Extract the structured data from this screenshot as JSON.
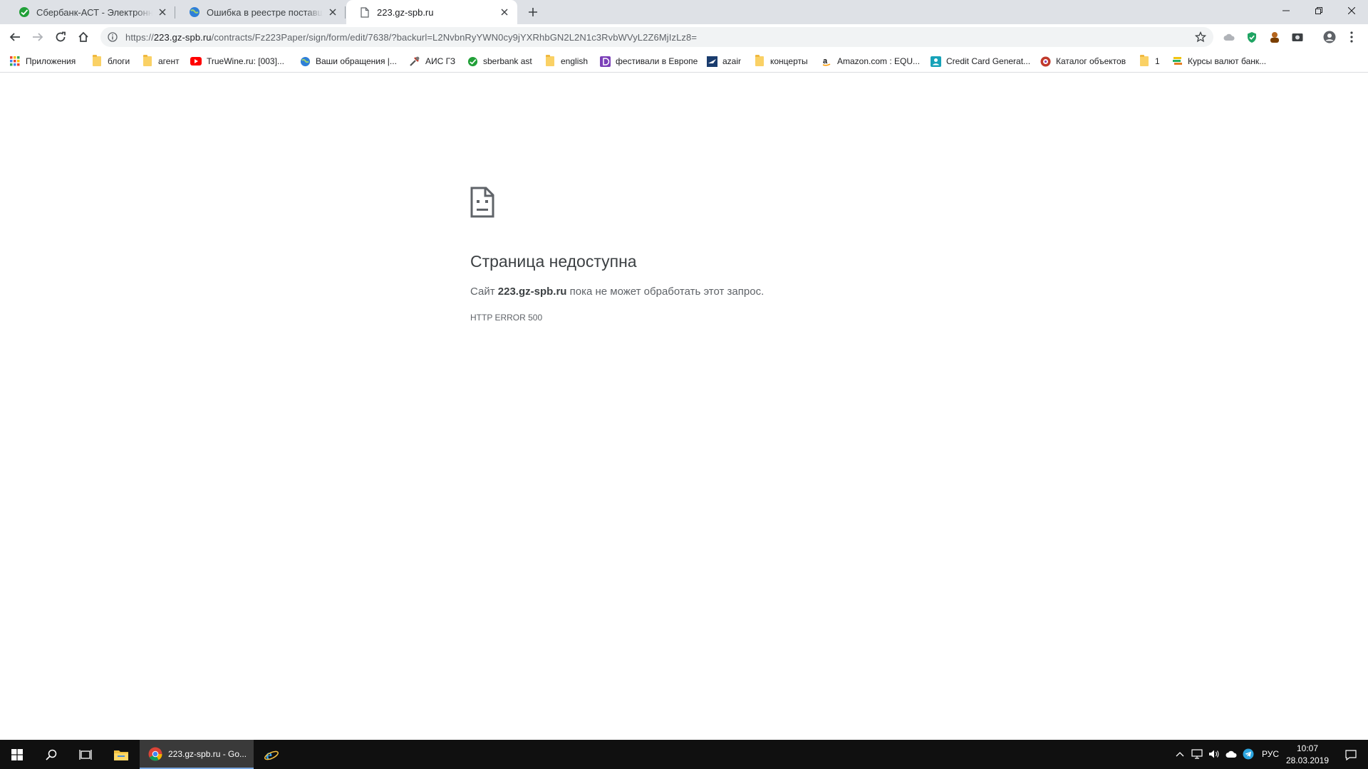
{
  "browser": {
    "tabs": [
      {
        "title": "Сбербанк-АСТ - Электронная то",
        "favicon": "sberbank-logo-icon",
        "active": false
      },
      {
        "title": "Ошибка в реестре поставщиков",
        "favicon": "globe-icon",
        "active": false
      },
      {
        "title": "223.gz-spb.ru",
        "favicon": "document-icon",
        "active": true
      }
    ],
    "address": {
      "scheme": "https://",
      "host": "223.gz-spb.ru",
      "path": "/contracts/Fz223Paper/sign/form/edit/7638/?backurl=L2NvbnRyYWN0cy9jYXRhbGN2L2N1c3RvbWVyL2Z6MjIzLz8="
    },
    "bookmarks": [
      {
        "label": "Приложения",
        "icon": "apps-grid-icon"
      },
      {
        "label": "блоги",
        "icon": "folder-icon"
      },
      {
        "label": "агент",
        "icon": "folder-icon"
      },
      {
        "label": "TrueWine.ru: [003]...",
        "icon": "youtube-icon"
      },
      {
        "label": "Ваши обращения |...",
        "icon": "globe-icon"
      },
      {
        "label": "АИС ГЗ",
        "icon": "tools-icon"
      },
      {
        "label": "sberbank ast",
        "icon": "sberbank-logo-icon"
      },
      {
        "label": "english",
        "icon": "folder-icon"
      },
      {
        "label": "фестивали в Европе",
        "icon": "purple-d-icon"
      },
      {
        "label": "azair",
        "icon": "plane-icon"
      },
      {
        "label": "концерты",
        "icon": "folder-icon"
      },
      {
        "label": "Amazon.com : EQU...",
        "icon": "amazon-icon"
      },
      {
        "label": "Credit Card Generat...",
        "icon": "card-user-icon"
      },
      {
        "label": "Каталог объектов",
        "icon": "catalog-icon"
      },
      {
        "label": "1",
        "icon": "folder-icon"
      },
      {
        "label": "Курсы валют банк...",
        "icon": "coins-icon"
      }
    ]
  },
  "error": {
    "title": "Страница недоступна",
    "msg_prefix": "Сайт ",
    "msg_host": "223.gz-spb.ru",
    "msg_suffix": " пока не может обработать этот запрос.",
    "code": "HTTP ERROR 500"
  },
  "taskbar": {
    "app_label": "223.gz-spb.ru - Go...",
    "language": "РУС",
    "time": "10:07",
    "date": "28.03.2019"
  },
  "colors": {
    "tabstrip": "#dee1e6",
    "taskbar": "#101010",
    "sberbank_green": "#21a038"
  }
}
